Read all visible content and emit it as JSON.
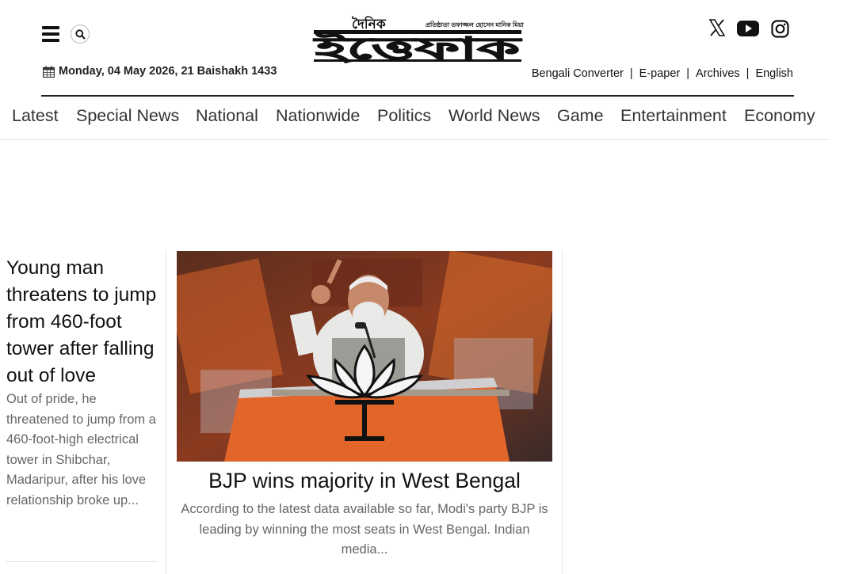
{
  "header": {
    "logo_small": "দৈনিক",
    "logo_main": "ইত্তেফাক",
    "logo_tagline": "প্রতিষ্ঠাতা তফাজ্জল হোসেন মানিক মিয়া",
    "date": "Monday, 04 May 2026, 21 Baishakh 1433",
    "social_icons": [
      "x-icon",
      "youtube-icon",
      "instagram-icon"
    ],
    "links": [
      {
        "label": "Bengali Converter"
      },
      {
        "label": "E-paper"
      },
      {
        "label": "Archives"
      },
      {
        "label": "English"
      }
    ],
    "link_separator": "|"
  },
  "nav": {
    "items": [
      {
        "label": "Latest"
      },
      {
        "label": "Special News"
      },
      {
        "label": "National"
      },
      {
        "label": "Nationwide"
      },
      {
        "label": "Politics"
      },
      {
        "label": "World News"
      },
      {
        "label": "Game"
      },
      {
        "label": "Entertainment"
      },
      {
        "label": "Economy"
      }
    ]
  },
  "stories": {
    "left": {
      "title": "Young man threatens to jump from 460-foot tower after falling out of love",
      "summary": "Out of pride, he threatened to jump from a 460-foot-high electrical tower in Shibchar, Madaripur, after his love relationship broke up..."
    },
    "lead": {
      "title": "BJP wins majority in West Bengal",
      "summary": "According to the latest data available so far, Modi's party BJP is leading by winning the most seats in West Bengal. Indian media..."
    }
  },
  "colors": {
    "text": "#222222",
    "muted": "#666666",
    "bjp_orange": "#f07a2a"
  }
}
